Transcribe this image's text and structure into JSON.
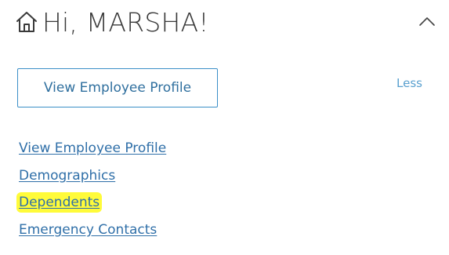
{
  "header": {
    "greeting": "Hi, MARSHA!",
    "home_icon": "home-icon",
    "toggle_icon": "chevron-up-icon"
  },
  "profile_button": {
    "label": "View Employee Profile"
  },
  "less_link": {
    "label": "Less"
  },
  "links": [
    {
      "label": "View Employee Profile",
      "highlighted": false
    },
    {
      "label": "Demographics",
      "highlighted": false
    },
    {
      "label": "Dependents",
      "highlighted": true
    },
    {
      "label": "Emergency Contacts",
      "highlighted": false
    }
  ],
  "colors": {
    "link": "#2f6fa8",
    "button_border": "#3b8fc7",
    "highlight": "#fffb3a",
    "heading_text": "#3a3a3a"
  }
}
